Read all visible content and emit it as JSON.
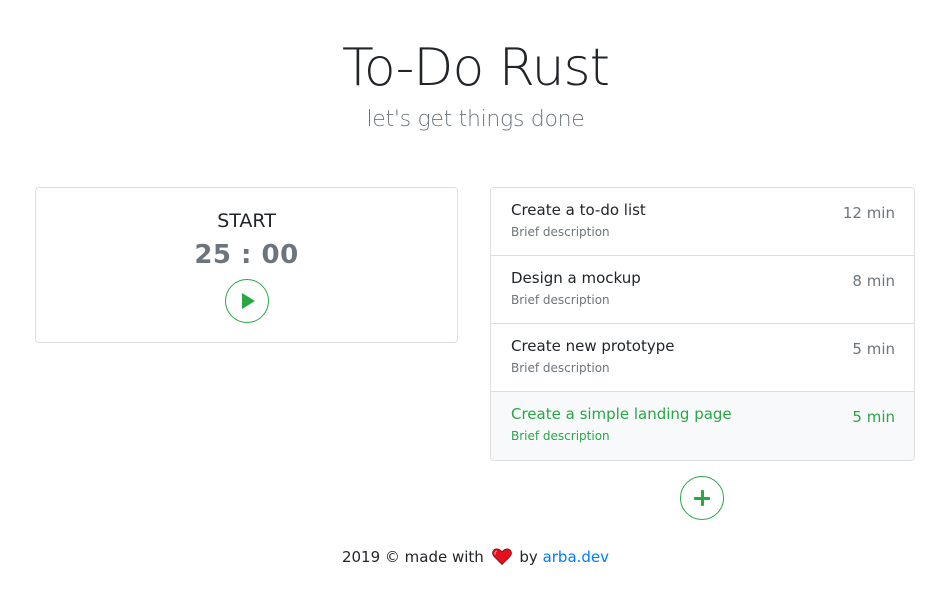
{
  "header": {
    "title": "To-Do Rust",
    "subtitle": "let's get things done"
  },
  "timer": {
    "label": "START",
    "value": "25 : 00",
    "play_icon": "play-icon"
  },
  "tasks": [
    {
      "title": "Create a to-do list",
      "description": "Brief description",
      "time": "12 min",
      "active": false
    },
    {
      "title": "Design a mockup",
      "description": "Brief description",
      "time": "8 min",
      "active": false
    },
    {
      "title": "Create new prototype",
      "description": "Brief description",
      "time": "5 min",
      "active": false
    },
    {
      "title": "Create a simple landing page",
      "description": "Brief description",
      "time": "5 min",
      "active": true
    }
  ],
  "add_button": {
    "icon": "plus-icon"
  },
  "footer": {
    "prefix": "2019 © made with",
    "heart_icon": "heart-icon",
    "by": "by",
    "link_text": "arba.dev"
  },
  "colors": {
    "accent": "#28a745",
    "muted": "#6c757d",
    "link": "#007bff",
    "heart": "#e3101e"
  }
}
